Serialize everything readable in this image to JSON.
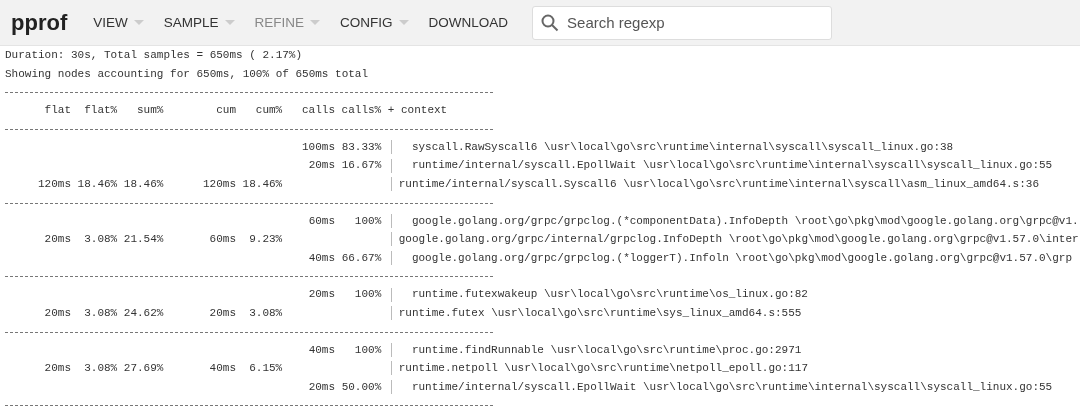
{
  "toolbar": {
    "logo": "pprof",
    "menus": [
      {
        "label": "VIEW",
        "dropdown": true,
        "disabled": false
      },
      {
        "label": "SAMPLE",
        "dropdown": true,
        "disabled": false
      },
      {
        "label": "REFINE",
        "dropdown": true,
        "disabled": true
      },
      {
        "label": "CONFIG",
        "dropdown": true,
        "disabled": false
      },
      {
        "label": "DOWNLOAD",
        "dropdown": false,
        "disabled": false
      }
    ],
    "search": {
      "placeholder": "Search regexp"
    }
  },
  "summary": [
    "Duration: 30s, Total samples = 650ms ( 2.17%)",
    "Showing nodes accounting for 650ms, 100% of 650ms total"
  ],
  "table": {
    "columns": [
      "flat",
      "flat%",
      "sum%",
      "cum",
      "cum%",
      "calls",
      "calls%",
      "+ context"
    ],
    "groups": [
      {
        "rows": [
          {
            "kind": "caller",
            "calls": "100ms",
            "calls_pct": "83.33%",
            "context": "syscall.RawSyscall6 \\usr\\local\\go\\src\\runtime\\internal\\syscall\\syscall_linux.go:38"
          },
          {
            "kind": "caller",
            "calls": "20ms",
            "calls_pct": "16.67%",
            "context": "runtime/internal/syscall.EpollWait \\usr\\local\\go\\src\\runtime\\internal\\syscall\\syscall_linux.go:55"
          },
          {
            "kind": "node",
            "flat": "120ms",
            "flat_pct": "18.46%",
            "sum_pct": "18.46%",
            "cum": "120ms",
            "cum_pct": "18.46%",
            "context": "runtime/internal/syscall.Syscall6 \\usr\\local\\go\\src\\runtime\\internal\\syscall\\asm_linux_amd64.s:36"
          }
        ]
      },
      {
        "rows": [
          {
            "kind": "caller",
            "calls": "60ms",
            "calls_pct": "100%",
            "context": "google.golang.org/grpc/grpclog.(*componentData).InfoDepth \\root\\go\\pkg\\mod\\google.golang.org\\grpc@v1."
          },
          {
            "kind": "node",
            "flat": "20ms",
            "flat_pct": "3.08%",
            "sum_pct": "21.54%",
            "cum": "60ms",
            "cum_pct": "9.23%",
            "context": "google.golang.org/grpc/internal/grpclog.InfoDepth \\root\\go\\pkg\\mod\\google.golang.org\\grpc@v1.57.0\\inter"
          },
          {
            "kind": "callee",
            "calls": "40ms",
            "calls_pct": "66.67%",
            "context": "google.golang.org/grpc/grpclog.(*loggerT).Infoln \\root\\go\\pkg\\mod\\google.golang.org\\grpc@v1.57.0\\grp"
          }
        ]
      },
      {
        "rows": [
          {
            "kind": "caller",
            "calls": "20ms",
            "calls_pct": "100%",
            "context": "runtime.futexwakeup \\usr\\local\\go\\src\\runtime\\os_linux.go:82"
          },
          {
            "kind": "node",
            "flat": "20ms",
            "flat_pct": "3.08%",
            "sum_pct": "24.62%",
            "cum": "20ms",
            "cum_pct": "3.08%",
            "context": "runtime.futex \\usr\\local\\go\\src\\runtime\\sys_linux_amd64.s:555"
          }
        ]
      },
      {
        "rows": [
          {
            "kind": "caller",
            "calls": "40ms",
            "calls_pct": "100%",
            "context": "runtime.findRunnable \\usr\\local\\go\\src\\runtime\\proc.go:2971"
          },
          {
            "kind": "node",
            "flat": "20ms",
            "flat_pct": "3.08%",
            "sum_pct": "27.69%",
            "cum": "40ms",
            "cum_pct": "6.15%",
            "context": "runtime.netpoll \\usr\\local\\go\\src\\runtime\\netpoll_epoll.go:117"
          },
          {
            "kind": "callee",
            "calls": "20ms",
            "calls_pct": "50.00%",
            "context": "runtime/internal/syscall.EpollWait \\usr\\local\\go\\src\\runtime\\internal\\syscall\\syscall_linux.go:55"
          }
        ]
      }
    ]
  }
}
